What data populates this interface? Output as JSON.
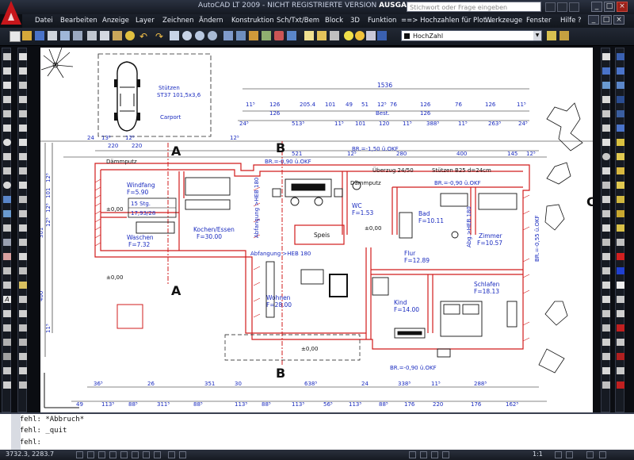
{
  "window": {
    "app": "AutoCAD LT 2009 - NICHT REGISTRIERTE VERSION ",
    "file": "AUSGABE.DXF",
    "search_placeholder": "Stichwort oder Frage eingeben",
    "buttons": [
      "_",
      "□",
      "×"
    ]
  },
  "menu": [
    "Datei",
    "Bearbeiten",
    "Anzeige",
    "Layer",
    "Zeichnen",
    "Ändern",
    "Konstruktion",
    "Sch/Txt/Bem",
    "Block",
    "3D",
    "Funktion",
    "==> Hochzahlen für Plot...",
    "Werkzeuge",
    "Fenster",
    "Hilfe ?"
  ],
  "toolbar": {
    "layer_dropdown": "HochZahl",
    "layer_state_icons": [
      "bulb-icon",
      "sun-icon",
      "lock-icon"
    ]
  },
  "drawing": {
    "stuetzen": [
      "Stützen",
      "ST37  101,5x3,6"
    ],
    "carport": "Carport",
    "section_a": "A",
    "section_b": "B",
    "section_c": "C",
    "daemmputz": "Dämmputz",
    "ueberzug": "Überzug 24/50",
    "stuetzen_b25": "Stützen B25  d=24cm",
    "abfangung_top": "Abfangung >HEB 180",
    "abfangung_mid": "Abfangung >HEB 180",
    "abfangung_right": "Abfangung >HEB 180",
    "abgang_right": "BR.=-0,55 ü.OKF",
    "br_top1": "BR.=-0,90  ü.OKF",
    "br_top2": "BR.=-1,50  ü.OKF",
    "br_top3": "BR.=-0,90  ü.OKF",
    "br_bottom": "BR.=-0,90  ü.OKF",
    "rooms": [
      {
        "name": "Windfang",
        "area": "F=5.90"
      },
      {
        "name": "Kochen/Essen",
        "area": "F=30.00"
      },
      {
        "name": "Waschen",
        "area": "F=7.32"
      },
      {
        "name": "WC",
        "area": "F=1.53"
      },
      {
        "name": "Bad",
        "area": "F=10.11"
      },
      {
        "name": "Zimmer",
        "area": "F=10.57"
      },
      {
        "name": "Flur",
        "area": "F=12.89"
      },
      {
        "name": "Wohnen",
        "area": "F=28.00"
      },
      {
        "name": "Kind",
        "area": "F=14.00"
      },
      {
        "name": "Schlafen",
        "area": "F=18.13"
      },
      {
        "name": "Speis",
        "area": ""
      }
    ],
    "stairs": [
      "15 Stg.",
      "17,93/28"
    ],
    "levels": [
      "±0,00",
      "±0,00",
      "±0,00",
      "±0,00"
    ],
    "abgang_in_room": "Abg.>HEB 180",
    "dims_top_total": "1536",
    "dims_top_row1": [
      "11⁵",
      "126",
      "205.4",
      "101",
      "49",
      "51",
      "12⁵",
      "76",
      "126",
      "76",
      "126",
      "11⁵"
    ],
    "dims_top_row2": [
      "126",
      "Best.",
      "126"
    ],
    "dims_top_row3": [
      "24⁵",
      "513⁵",
      "11⁵",
      "101",
      "120",
      "11⁵",
      "388⁵",
      "11⁵",
      "263⁵",
      "24⁵"
    ],
    "dims_top_row4": [
      "24",
      "13⁵",
      "220",
      "12⁵",
      "220",
      "12⁵",
      "521",
      "12⁵",
      "280",
      "400",
      "145",
      "12⁵"
    ],
    "dims_bottom_row1": [
      "36⁵",
      "26",
      "351",
      "30",
      "638⁵",
      "24",
      "338⁵",
      "11⁵",
      "288⁵"
    ],
    "dims_bottom_row2": [
      "49",
      "113⁵",
      "88⁵",
      "311⁵",
      "88⁵",
      "113⁵",
      "88⁵",
      "113⁵",
      "56⁵",
      "113⁵",
      "88⁵",
      "176",
      "220",
      "176",
      "162⁵"
    ],
    "dims_left": [
      "12⁵",
      "101",
      "12⁵",
      "301",
      "400",
      "12⁵",
      "11⁵"
    ]
  },
  "command": {
    "lines": [
      "Befehl: *Abbruch*",
      "Befehl: _quit",
      "Befehl:"
    ]
  },
  "status": {
    "coords": "3732.3, 2283.7",
    "scale": "1:1"
  }
}
